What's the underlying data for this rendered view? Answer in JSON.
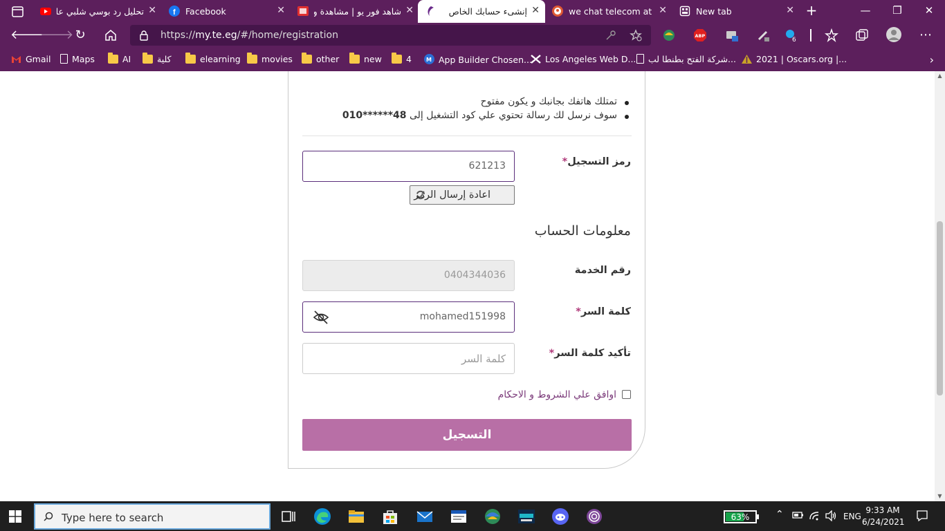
{
  "browser": {
    "tabs": [
      {
        "title": "تحليل رد بوسي شلبي علي",
        "icon": "youtube-icon",
        "active": false
      },
      {
        "title": "Facebook",
        "icon": "facebook-icon",
        "active": false
      },
      {
        "title": "شاهد فور يو | مشاهدة و",
        "icon": "shahid-icon",
        "active": false
      },
      {
        "title": "إنشىء حسابك الخاص",
        "icon": "we-icon",
        "active": true
      },
      {
        "title": "we chat telecom at Du",
        "icon": "duckduckgo-icon",
        "active": false
      },
      {
        "title": "New tab",
        "icon": "newtab-icon",
        "active": false
      }
    ],
    "url_scheme": "https://",
    "url_host": "my.te.eg",
    "url_path": "/#/home/registration",
    "bookmarks": [
      {
        "label": "Gmail",
        "icon": "gmail-icon"
      },
      {
        "label": "Maps",
        "icon": "page-icon"
      },
      {
        "label": "AI",
        "icon": "folder-icon"
      },
      {
        "label": "كلية",
        "icon": "folder-icon"
      },
      {
        "label": "elearning",
        "icon": "folder-icon"
      },
      {
        "label": "movies",
        "icon": "folder-icon"
      },
      {
        "label": "other",
        "icon": "folder-icon"
      },
      {
        "label": "new",
        "icon": "folder-icon"
      },
      {
        "label": "4",
        "icon": "folder-icon"
      },
      {
        "label": "App Builder Chosen...",
        "icon": "appbuilder-icon"
      },
      {
        "label": "Los Angeles Web D...",
        "icon": "x-icon"
      },
      {
        "label": "شركة الفتح بطنطا لب...",
        "icon": "page-icon"
      },
      {
        "label": "2021 | Oscars.org |...",
        "icon": "oscars-icon"
      }
    ],
    "ext_badge": "6"
  },
  "form": {
    "instructions": [
      "تمتلك هاتفك بجانبك و يكون مفتوح",
      "سوف نرسل لك رسالة تحتوي علي كود التشغيل إلى"
    ],
    "masked_number": "010******48",
    "code_label": "رمز التسجيل",
    "code_value": "621213",
    "resend_label": "اعادة إرسال الرمز",
    "account_section": "معلومات الحساب",
    "service_label": "رقم الخدمة",
    "service_value": "0404344036",
    "password_label": "كلمة السر",
    "password_value": "mohamed151998",
    "confirm_label": "تأكيد كلمة السر",
    "confirm_placeholder": "كلمة السر",
    "required_mark": "*",
    "agree_label": "اوافق علي الشروط و الاحكام",
    "submit_label": "التسجيل"
  },
  "taskbar": {
    "search_placeholder": "Type here to search",
    "battery_percent": 63,
    "battery_text": "63%",
    "language": "ENG",
    "time": "9:33 AM",
    "date": "6/24/2021"
  },
  "colors": {
    "brand_purple": "#5c1f5c",
    "button_pink": "#b86fa6",
    "required": "#b03a7a"
  }
}
